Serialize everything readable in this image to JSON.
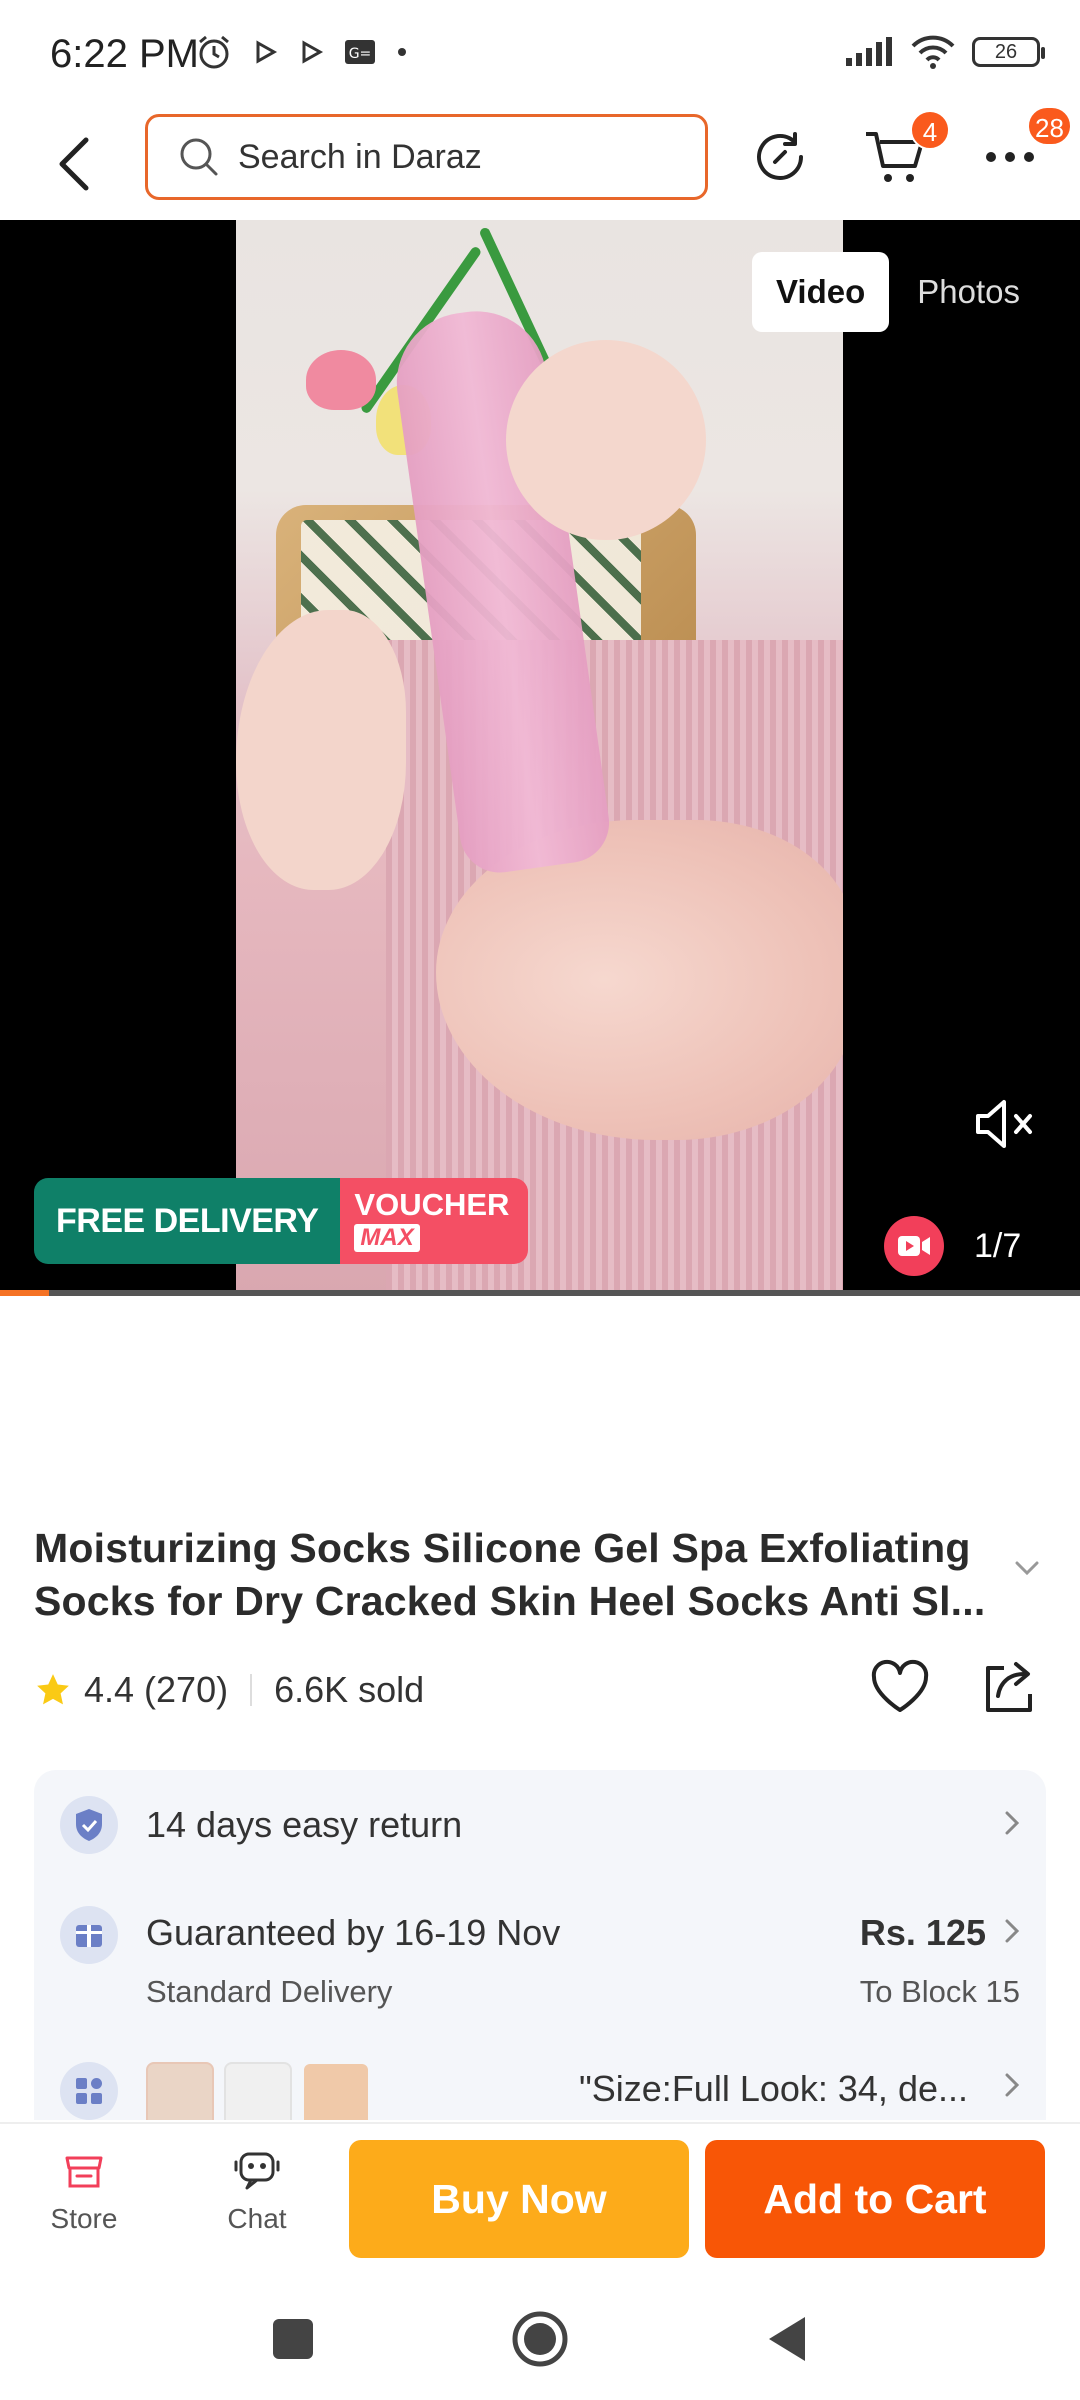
{
  "status_bar": {
    "time": "6:22 PM",
    "battery": "26",
    "icons": [
      "alarm-icon",
      "play-icon",
      "play-icon",
      "gmail-icon",
      "dot-icon",
      "signal-icon",
      "wifi-icon",
      "battery-icon"
    ]
  },
  "nav": {
    "search_placeholder": "Search in Daraz",
    "cart_badge": "4",
    "more_badge": "28"
  },
  "media": {
    "tabs": [
      "Video",
      "Photos"
    ],
    "active_tab": "Video",
    "promo_free": "FREE DELIVERY",
    "promo_voucher": "VOUCHER",
    "promo_max": "MAX",
    "counter": "1/7",
    "progress": 0.045
  },
  "product": {
    "title": "Moisturizing Socks Silicone Gel Spa Exfoliating Socks for Dry Cracked Skin Heel Socks Anti Sl...",
    "rating": "4.4",
    "reviews": "(270)",
    "sold": "6.6K sold"
  },
  "info": {
    "return_text": "14 days easy return",
    "delivery_text": "Guaranteed by 16-19 Nov",
    "delivery_sub": "Standard Delivery",
    "delivery_price": "Rs. 125",
    "delivery_dest": "To Block 15",
    "variant_text": "\"Size:Full Look: 34, de..."
  },
  "actions": {
    "store": "Store",
    "chat": "Chat",
    "buy_now": "Buy Now",
    "add_to_cart": "Add to Cart"
  },
  "colors": {
    "accent": "#f85606",
    "buy_now": "#fdab1a",
    "free_delivery": "#0f8068",
    "voucher": "#f44f64"
  }
}
